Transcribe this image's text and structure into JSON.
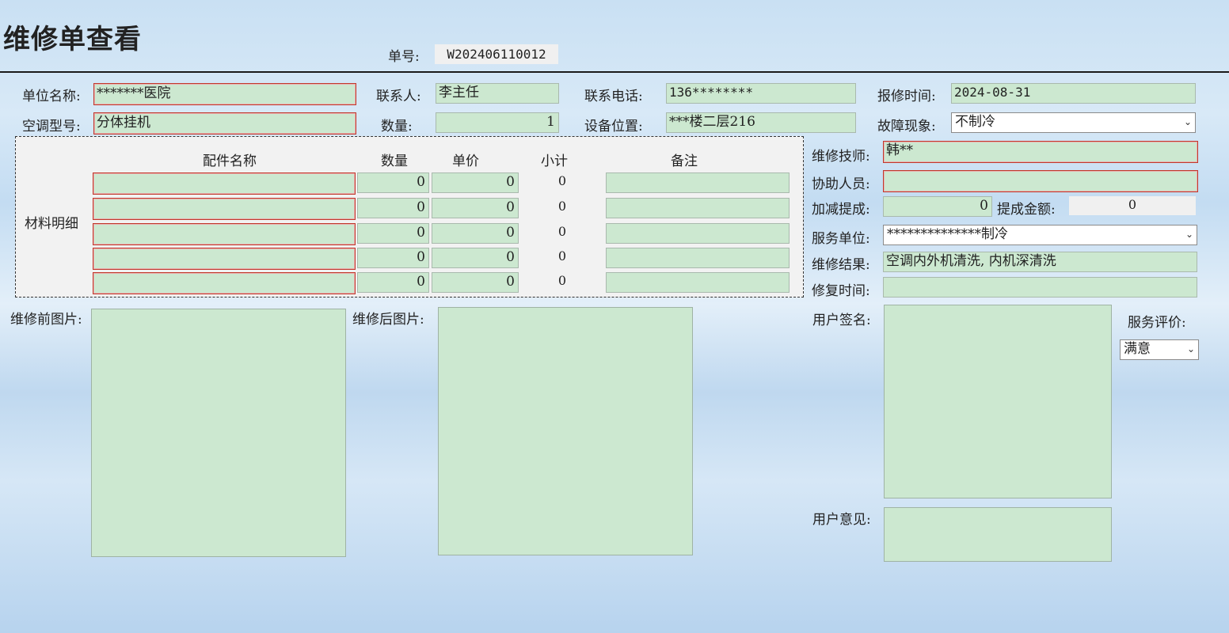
{
  "page": {
    "title": "维修单查看"
  },
  "order": {
    "label": "单号:",
    "value": "W202406110012"
  },
  "form": {
    "unit_name": {
      "label": "单位名称:",
      "value": "*******医院"
    },
    "contact": {
      "label": "联系人:",
      "value": "李主任"
    },
    "phone": {
      "label": "联系电话:",
      "value": "136********"
    },
    "report_time": {
      "label": "报修时间:",
      "value": "2024-08-31"
    },
    "ac_model": {
      "label": "空调型号:",
      "value": "分体挂机"
    },
    "quantity": {
      "label": "数量:",
      "value": "1"
    },
    "location": {
      "label": "设备位置:",
      "value": "***楼二层216"
    },
    "fault": {
      "label": "故障现象:",
      "value": "不制冷"
    }
  },
  "materials": {
    "section_label": "材料明细",
    "headers": {
      "name": "配件名称",
      "qty": "数量",
      "price": "单价",
      "subtotal": "小计",
      "note": "备注"
    },
    "rows": [
      {
        "name": "",
        "qty": "0",
        "price": "0",
        "subtotal": "0",
        "note": ""
      },
      {
        "name": "",
        "qty": "0",
        "price": "0",
        "subtotal": "0",
        "note": ""
      },
      {
        "name": "",
        "qty": "0",
        "price": "0",
        "subtotal": "0",
        "note": ""
      },
      {
        "name": "",
        "qty": "0",
        "price": "0",
        "subtotal": "0",
        "note": ""
      },
      {
        "name": "",
        "qty": "0",
        "price": "0",
        "subtotal": "0",
        "note": ""
      }
    ]
  },
  "service": {
    "technician": {
      "label": "维修技师:",
      "value": "韩**"
    },
    "assistants": {
      "label": "协助人员:",
      "value": ""
    },
    "commission_adj": {
      "label": "加减提成:",
      "value": "0"
    },
    "commission_amount": {
      "label": "提成金额:",
      "value": "0"
    },
    "service_unit": {
      "label": "服务单位:",
      "value": "**************制冷"
    },
    "result": {
      "label": "维修结果:",
      "value": "空调内外机清洗, 内机深清洗"
    },
    "repair_time": {
      "label": "修复时间:",
      "value": ""
    }
  },
  "images": {
    "before_label": "维修前图片:",
    "after_label": "维修后图片:",
    "signature_label": "用户签名:",
    "opinion_label": "用户意见:"
  },
  "evaluation": {
    "label": "服务评价:",
    "value": "满意"
  },
  "icons": {
    "dropdown": "chevron-down-icon"
  },
  "colors": {
    "field_bg": "#cce8d0",
    "required_border": "#c0392b",
    "readonly_bg": "#f0f0f0"
  }
}
